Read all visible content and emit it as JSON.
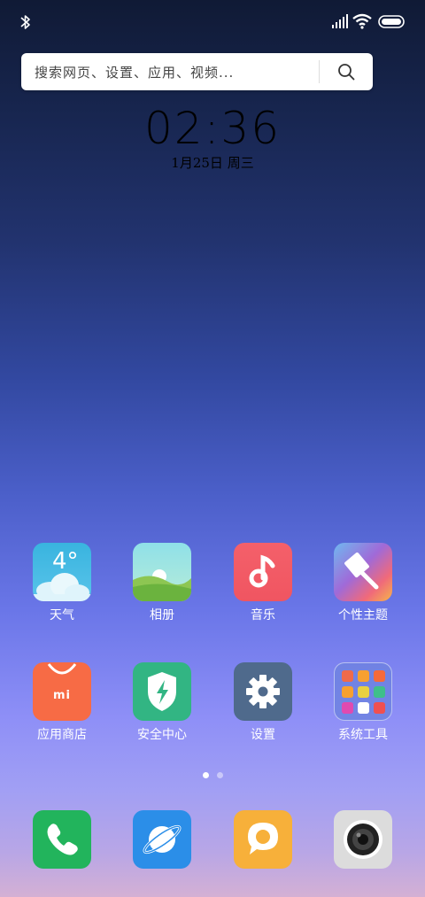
{
  "search": {
    "placeholder": "搜索网页、设置、应用、视频..."
  },
  "clock": {
    "time": "02:36",
    "date": "1月25日 周三"
  },
  "apps_row1": [
    {
      "label": "天气",
      "temp": "4°"
    },
    {
      "label": "相册"
    },
    {
      "label": "音乐"
    },
    {
      "label": "个性主题"
    }
  ],
  "apps_row2": [
    {
      "label": "应用商店",
      "icon_text": "mi"
    },
    {
      "label": "安全中心"
    },
    {
      "label": "设置"
    },
    {
      "label": "系统工具"
    }
  ],
  "page_indicator": {
    "pages": 2,
    "current": 1
  },
  "dock": [
    "phone-icon",
    "browser-icon",
    "messages-icon",
    "camera-icon"
  ],
  "colors": {
    "weather": "#3db8e0",
    "gallery": "#8fd98f",
    "music": "#f25b66",
    "themes": "#e8a33a",
    "store": "#f76b45",
    "security": "#32b583",
    "settings": "#4f6a8c",
    "tools": "#5c73d8",
    "phone": "#22b45c",
    "browser": "#2b8ee8",
    "messages": "#f7b03a",
    "camera": "#dcdcdc"
  }
}
